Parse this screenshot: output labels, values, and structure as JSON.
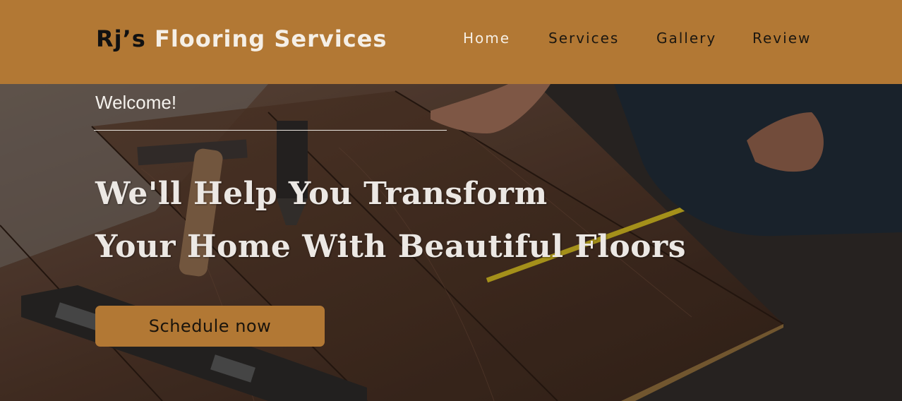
{
  "brand": {
    "part1": "Rj’s",
    "part2": "Flooring Services"
  },
  "nav": {
    "items": [
      {
        "label": "Home",
        "active": true
      },
      {
        "label": "Services",
        "active": false
      },
      {
        "label": "Gallery",
        "active": false
      },
      {
        "label": "Review",
        "active": false
      }
    ]
  },
  "hero": {
    "welcome": "Welcome!",
    "headline_line1": "We'll Help You Transform",
    "headline_line2": "Your Home With Beautiful Floors",
    "cta_label": "Schedule now",
    "image_subject": "worker installing wooden floor planks with hammer, tape measure and level"
  },
  "colors": {
    "header_bg": "#b27834",
    "button_bg": "#b27834",
    "text_light": "#f4f1ec",
    "text_dark": "#1a140c"
  }
}
